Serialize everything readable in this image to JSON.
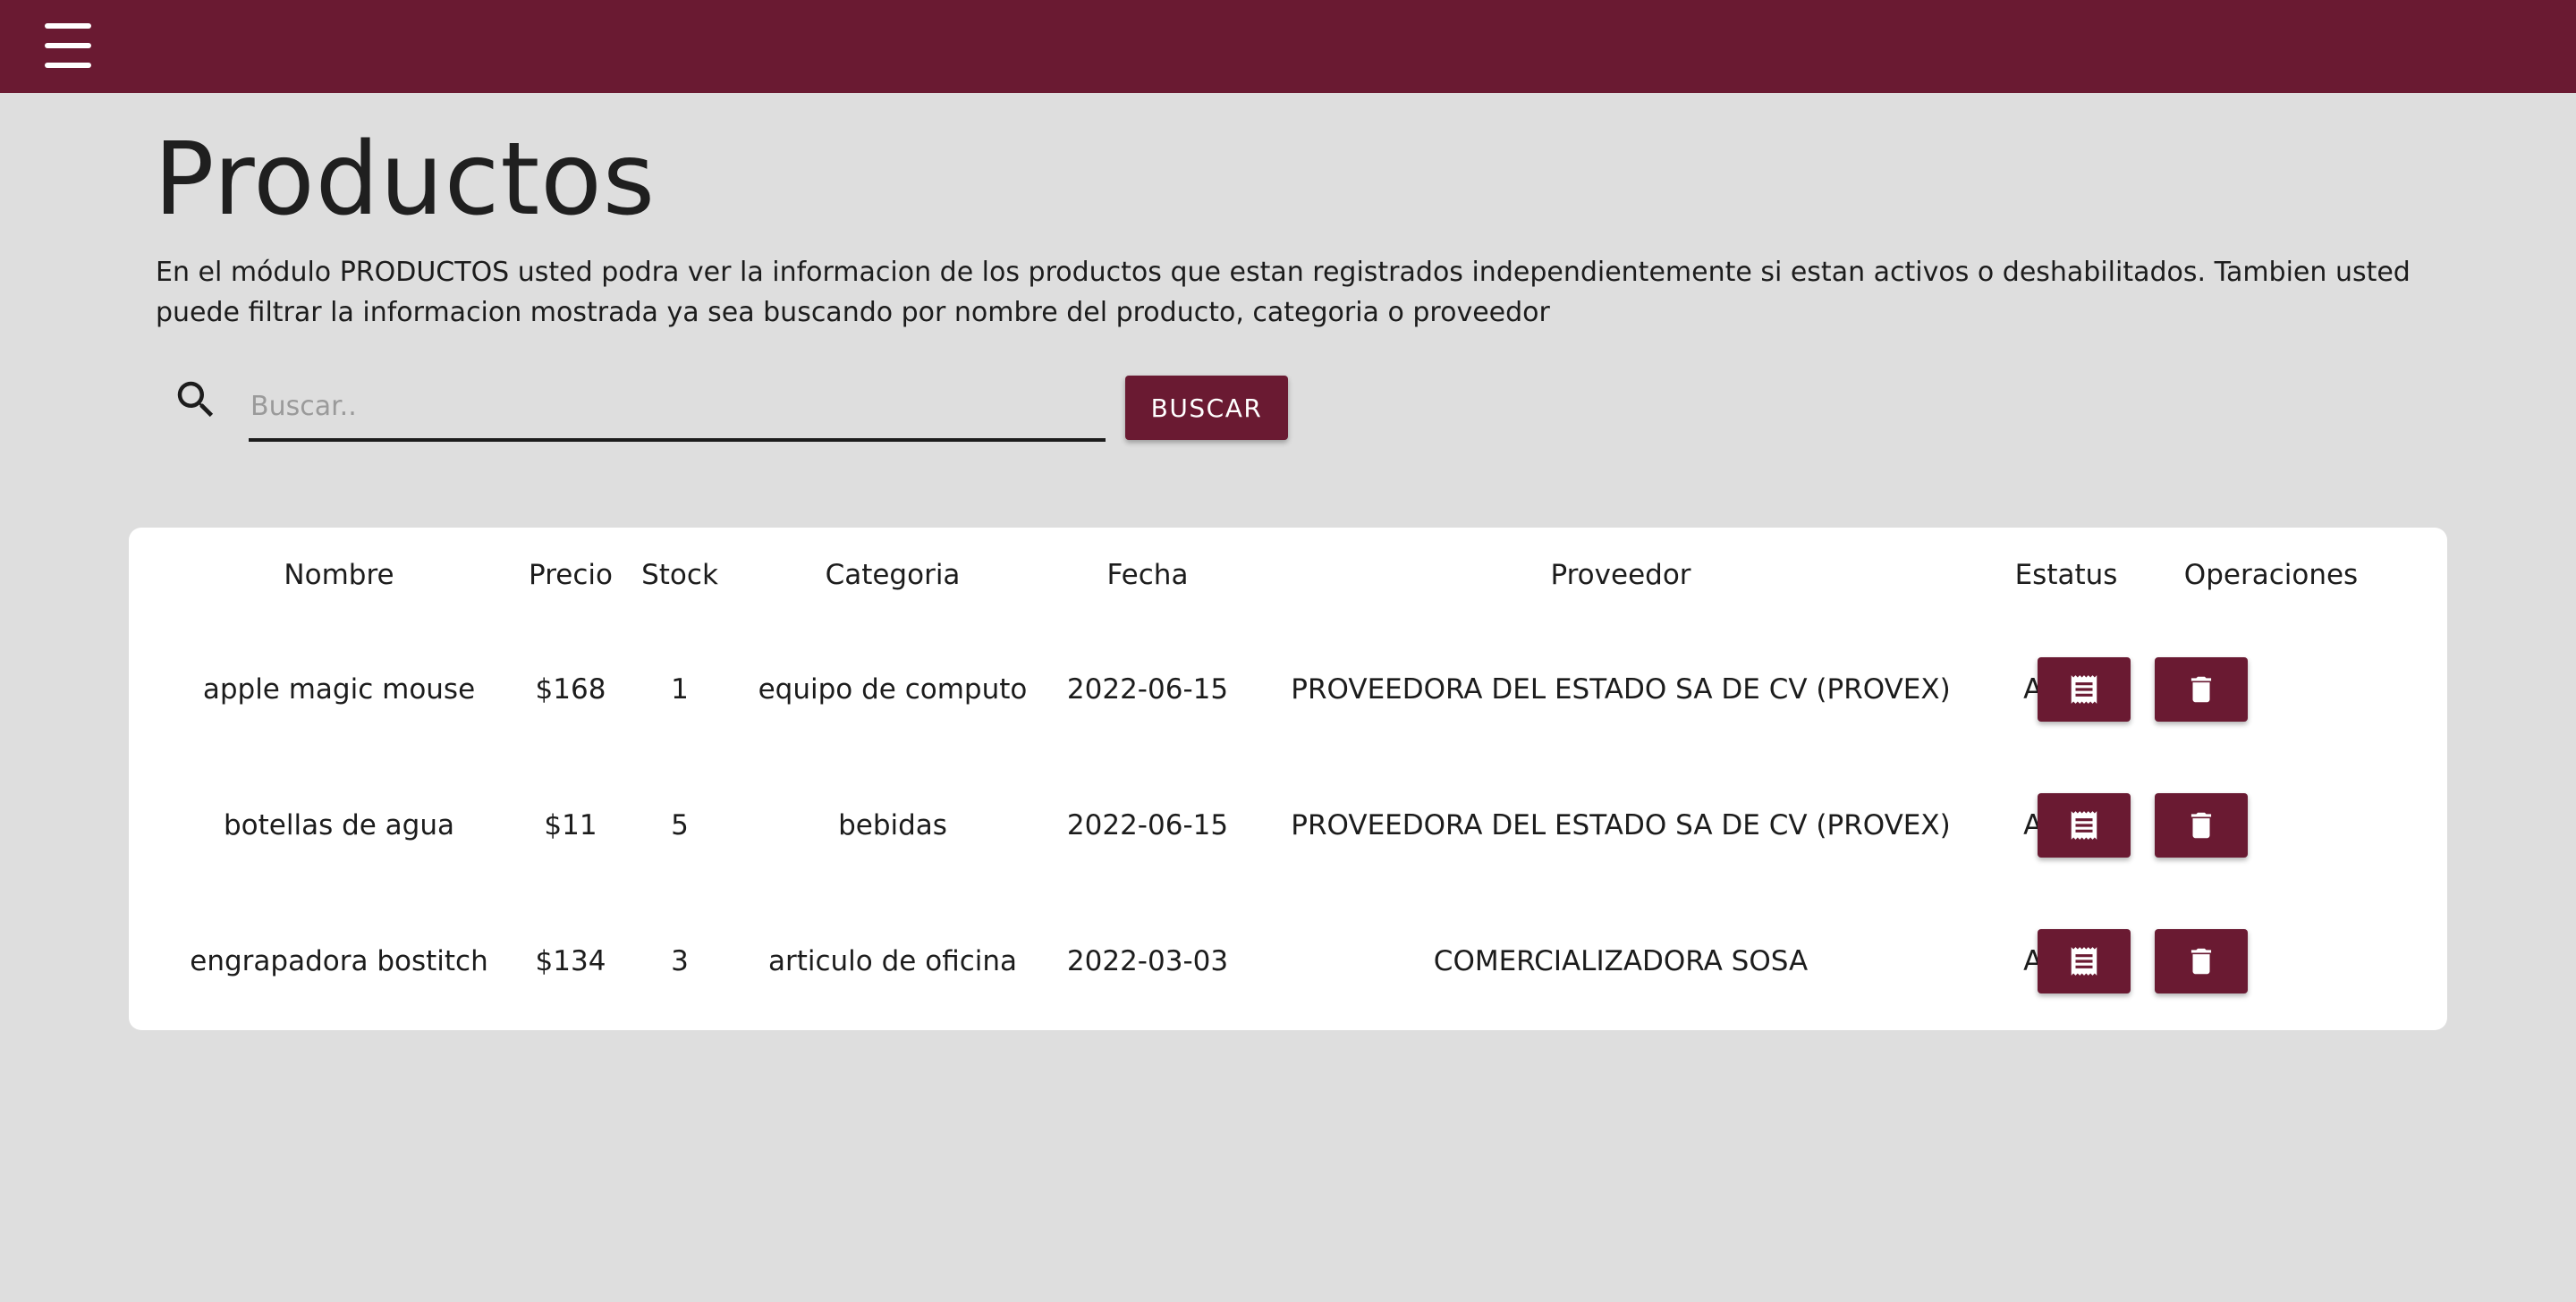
{
  "header": {
    "menu_icon": "hamburger-menu-icon",
    "brand_color": "#6a1a32"
  },
  "page": {
    "title": "Productos",
    "description": "En el módulo PRODUCTOS usted podra ver la informacion de los productos que estan registrados independientemente si estan activos o deshabilitados. Tambien usted puede filtrar la informacion mostrada ya sea buscando por nombre del producto, categoria o proveedor"
  },
  "search": {
    "icon": "search-icon",
    "placeholder": "Buscar..",
    "value": "",
    "button_label": "BUSCAR"
  },
  "table": {
    "columns": [
      "Nombre",
      "Precio",
      "Stock",
      "Categoria",
      "Fecha",
      "Proveedor",
      "Estatus",
      "Operaciones"
    ],
    "rows": [
      {
        "nombre": "apple magic mouse",
        "precio": "$168",
        "stock": "1",
        "categoria": "equipo de computo",
        "fecha": "2022-06-15",
        "proveedor": "PROVEEDORA DEL ESTADO SA DE CV (PROVEX)",
        "estatus": "Activo"
      },
      {
        "nombre": "botellas de agua",
        "precio": "$11",
        "stock": "5",
        "categoria": "bebidas",
        "fecha": "2022-06-15",
        "proveedor": "PROVEEDORA DEL ESTADO SA DE CV (PROVEX)",
        "estatus": "Activo"
      },
      {
        "nombre": "engrapadora bostitch",
        "precio": "$134",
        "stock": "3",
        "categoria": "articulo de oficina",
        "fecha": "2022-03-03",
        "proveedor": "COMERCIALIZADORA SOSA",
        "estatus": "Activo"
      }
    ],
    "operations": {
      "edit_icon": "receipt-icon",
      "delete_icon": "trash-icon"
    }
  }
}
